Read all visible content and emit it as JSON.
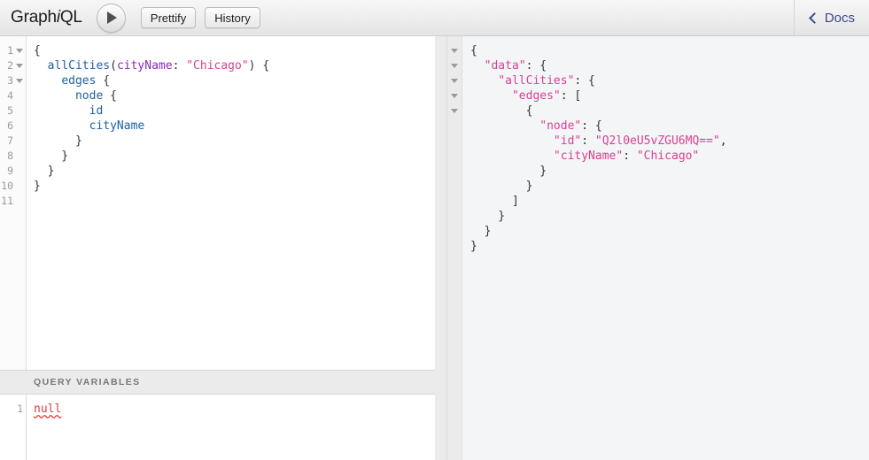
{
  "app": {
    "title": "GraphiQL",
    "title_prefix": "Graph",
    "title_italic": "i",
    "title_suffix": "QL"
  },
  "toolbar": {
    "execute_label": "",
    "execute_icon": "play-icon",
    "prettify_label": "Prettify",
    "history_label": "History",
    "docs_label": "Docs",
    "docs_icon": "chevron-left-icon"
  },
  "query_editor": {
    "line_numbers": [
      "1",
      "2",
      "3",
      "4",
      "5",
      "6",
      "7",
      "8",
      "9",
      "10",
      "11"
    ],
    "foldable_lines": [
      1,
      2,
      3
    ],
    "lines": [
      {
        "n": "1",
        "tokens": [
          {
            "t": "{",
            "c": "t-punct"
          }
        ]
      },
      {
        "n": "2",
        "tokens": [
          {
            "t": "  ",
            "c": "t-punct"
          },
          {
            "t": "allCities",
            "c": "t-field"
          },
          {
            "t": "(",
            "c": "t-punct"
          },
          {
            "t": "cityName",
            "c": "t-arg"
          },
          {
            "t": ": ",
            "c": "t-punct"
          },
          {
            "t": "\"Chicago\"",
            "c": "t-string"
          },
          {
            "t": ") {",
            "c": "t-punct"
          }
        ]
      },
      {
        "n": "3",
        "tokens": [
          {
            "t": "    ",
            "c": "t-punct"
          },
          {
            "t": "edges",
            "c": "t-field"
          },
          {
            "t": " {",
            "c": "t-punct"
          }
        ]
      },
      {
        "n": "4",
        "tokens": [
          {
            "t": "      ",
            "c": "t-punct"
          },
          {
            "t": "node",
            "c": "t-field"
          },
          {
            "t": " {",
            "c": "t-punct"
          }
        ]
      },
      {
        "n": "5",
        "tokens": [
          {
            "t": "        ",
            "c": "t-punct"
          },
          {
            "t": "id",
            "c": "t-field"
          }
        ]
      },
      {
        "n": "6",
        "tokens": [
          {
            "t": "        ",
            "c": "t-punct"
          },
          {
            "t": "cityName",
            "c": "t-field"
          }
        ]
      },
      {
        "n": "7",
        "tokens": [
          {
            "t": "      }",
            "c": "t-punct"
          }
        ]
      },
      {
        "n": "8",
        "tokens": [
          {
            "t": "    }",
            "c": "t-punct"
          }
        ]
      },
      {
        "n": "9",
        "tokens": [
          {
            "t": "  }",
            "c": "t-punct"
          }
        ]
      },
      {
        "n": "10",
        "tokens": [
          {
            "t": "}",
            "c": "t-punct"
          }
        ]
      },
      {
        "n": "11",
        "tokens": []
      }
    ]
  },
  "variables_pane": {
    "header_label": "QUERY VARIABLES",
    "line_numbers": [
      "1"
    ],
    "value": "null"
  },
  "result_viewer": {
    "fold_count": 5,
    "lines": [
      {
        "tokens": [
          {
            "t": "{",
            "c": "r-punct"
          }
        ]
      },
      {
        "tokens": [
          {
            "t": "  ",
            "c": "r-punct"
          },
          {
            "t": "\"data\"",
            "c": "r-key"
          },
          {
            "t": ": {",
            "c": "r-punct"
          }
        ]
      },
      {
        "tokens": [
          {
            "t": "    ",
            "c": "r-punct"
          },
          {
            "t": "\"allCities\"",
            "c": "r-key"
          },
          {
            "t": ": {",
            "c": "r-punct"
          }
        ]
      },
      {
        "tokens": [
          {
            "t": "      ",
            "c": "r-punct"
          },
          {
            "t": "\"edges\"",
            "c": "r-key"
          },
          {
            "t": ": [",
            "c": "r-punct"
          }
        ]
      },
      {
        "tokens": [
          {
            "t": "        {",
            "c": "r-punct"
          }
        ]
      },
      {
        "tokens": [
          {
            "t": "          ",
            "c": "r-punct"
          },
          {
            "t": "\"node\"",
            "c": "r-key"
          },
          {
            "t": ": {",
            "c": "r-punct"
          }
        ]
      },
      {
        "tokens": [
          {
            "t": "            ",
            "c": "r-punct"
          },
          {
            "t": "\"id\"",
            "c": "r-key"
          },
          {
            "t": ": ",
            "c": "r-punct"
          },
          {
            "t": "\"Q2l0eU5vZGU6MQ==\"",
            "c": "r-string"
          },
          {
            "t": ",",
            "c": "r-punct"
          }
        ]
      },
      {
        "tokens": [
          {
            "t": "            ",
            "c": "r-punct"
          },
          {
            "t": "\"cityName\"",
            "c": "r-key"
          },
          {
            "t": ": ",
            "c": "r-punct"
          },
          {
            "t": "\"Chicago\"",
            "c": "r-string"
          }
        ]
      },
      {
        "tokens": [
          {
            "t": "          }",
            "c": "r-punct"
          }
        ]
      },
      {
        "tokens": [
          {
            "t": "        }",
            "c": "r-punct"
          }
        ]
      },
      {
        "tokens": [
          {
            "t": "      ]",
            "c": "r-punct"
          }
        ]
      },
      {
        "tokens": [
          {
            "t": "    }",
            "c": "r-punct"
          }
        ]
      },
      {
        "tokens": [
          {
            "t": "  }",
            "c": "r-punct"
          }
        ]
      },
      {
        "tokens": [
          {
            "t": "}",
            "c": "r-punct"
          }
        ]
      }
    ]
  },
  "colors": {
    "accent_link": "#3b4a8c",
    "field": "#1f61a0",
    "argument": "#8b2bb9",
    "string": "#d64292",
    "error": "#d93f3f",
    "result_bg": "#f4f5f7"
  }
}
